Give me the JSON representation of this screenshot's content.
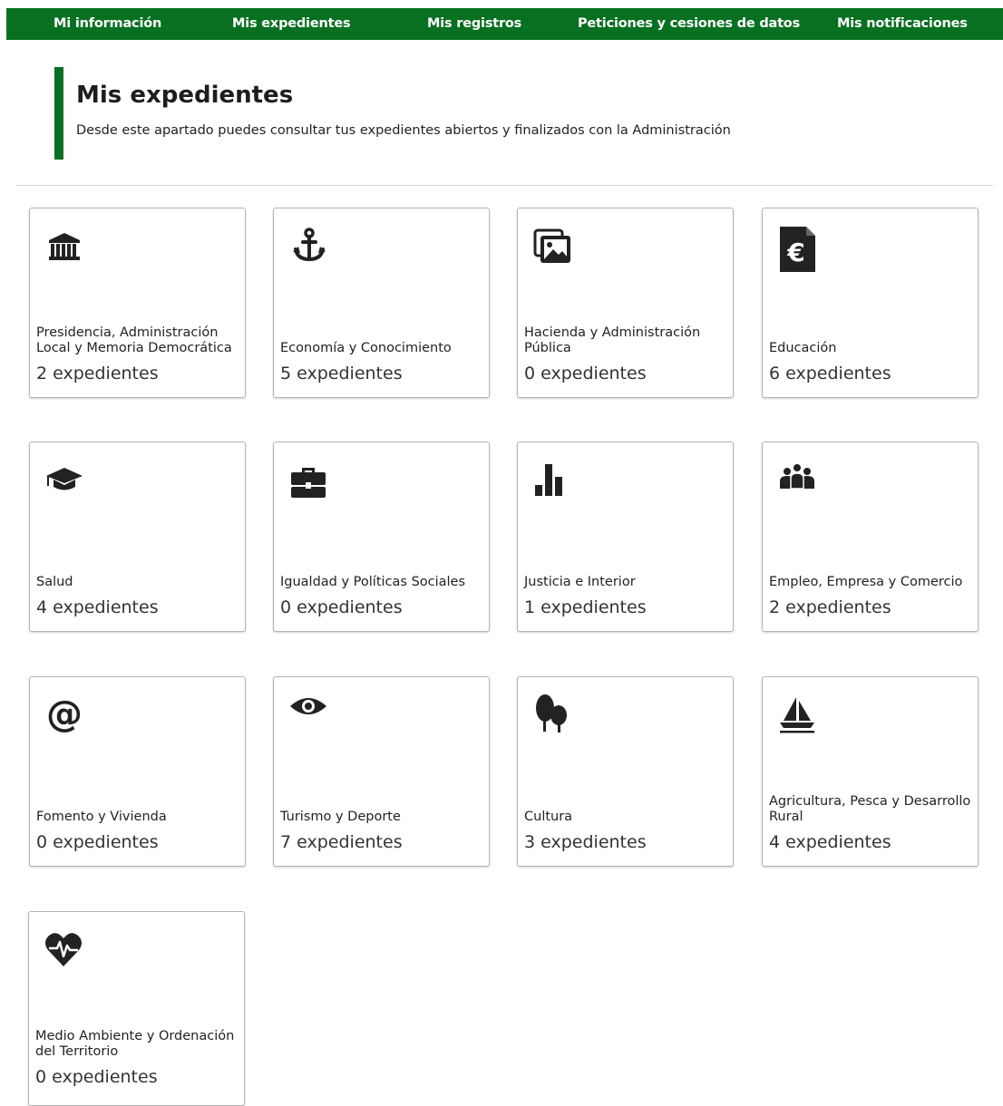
{
  "nav": {
    "items": [
      {
        "label": "Mi información"
      },
      {
        "label": "Mis expedientes"
      },
      {
        "label": "Mis registros"
      },
      {
        "label": "Peticiones y cesiones de datos"
      },
      {
        "label": "Mis notificaciones"
      }
    ],
    "background": "#087021"
  },
  "page": {
    "title": "Mis expedientes",
    "description": "Desde este apartado puedes consultar tus expedientes abiertos y finalizados con la Administración"
  },
  "cards": [
    {
      "icon": "institution-icon",
      "title": "Presidencia, Administración Local y Memoria Democrática",
      "count": "2 expedientes"
    },
    {
      "icon": "anchor-icon",
      "title": "Economía y Conocimiento",
      "count": "5 expedientes"
    },
    {
      "icon": "pictures-icon",
      "title": "Hacienda y Administración Pública",
      "count": "0 expedientes"
    },
    {
      "icon": "euro-document-icon",
      "title": "Educación",
      "count": "6 expedientes"
    },
    {
      "icon": "graduation-cap-icon",
      "title": "Salud",
      "count": "4 expedientes"
    },
    {
      "icon": "briefcase-icon",
      "title": "Igualdad y Políticas Sociales",
      "count": "0 expedientes"
    },
    {
      "icon": "bar-chart-icon",
      "title": "Justicia e Interior",
      "count": "1 expedientes"
    },
    {
      "icon": "people-group-icon",
      "title": "Empleo, Empresa y Comercio",
      "count": "2 expedientes"
    },
    {
      "icon": "at-sign-icon",
      "title": "Fomento y Vivienda",
      "count": "0 expedientes"
    },
    {
      "icon": "eye-icon",
      "title": "Turismo y Deporte",
      "count": "7 expedientes"
    },
    {
      "icon": "trees-icon",
      "title": "Cultura",
      "count": "3 expedientes"
    },
    {
      "icon": "sailboat-icon",
      "title": "Agricultura, Pesca y Desarrollo Rural",
      "count": "4 expedientes"
    },
    {
      "icon": "heartbeat-icon",
      "title": "Medio Ambiente y Ordenación del Territorio",
      "count": "0 expedientes"
    }
  ]
}
